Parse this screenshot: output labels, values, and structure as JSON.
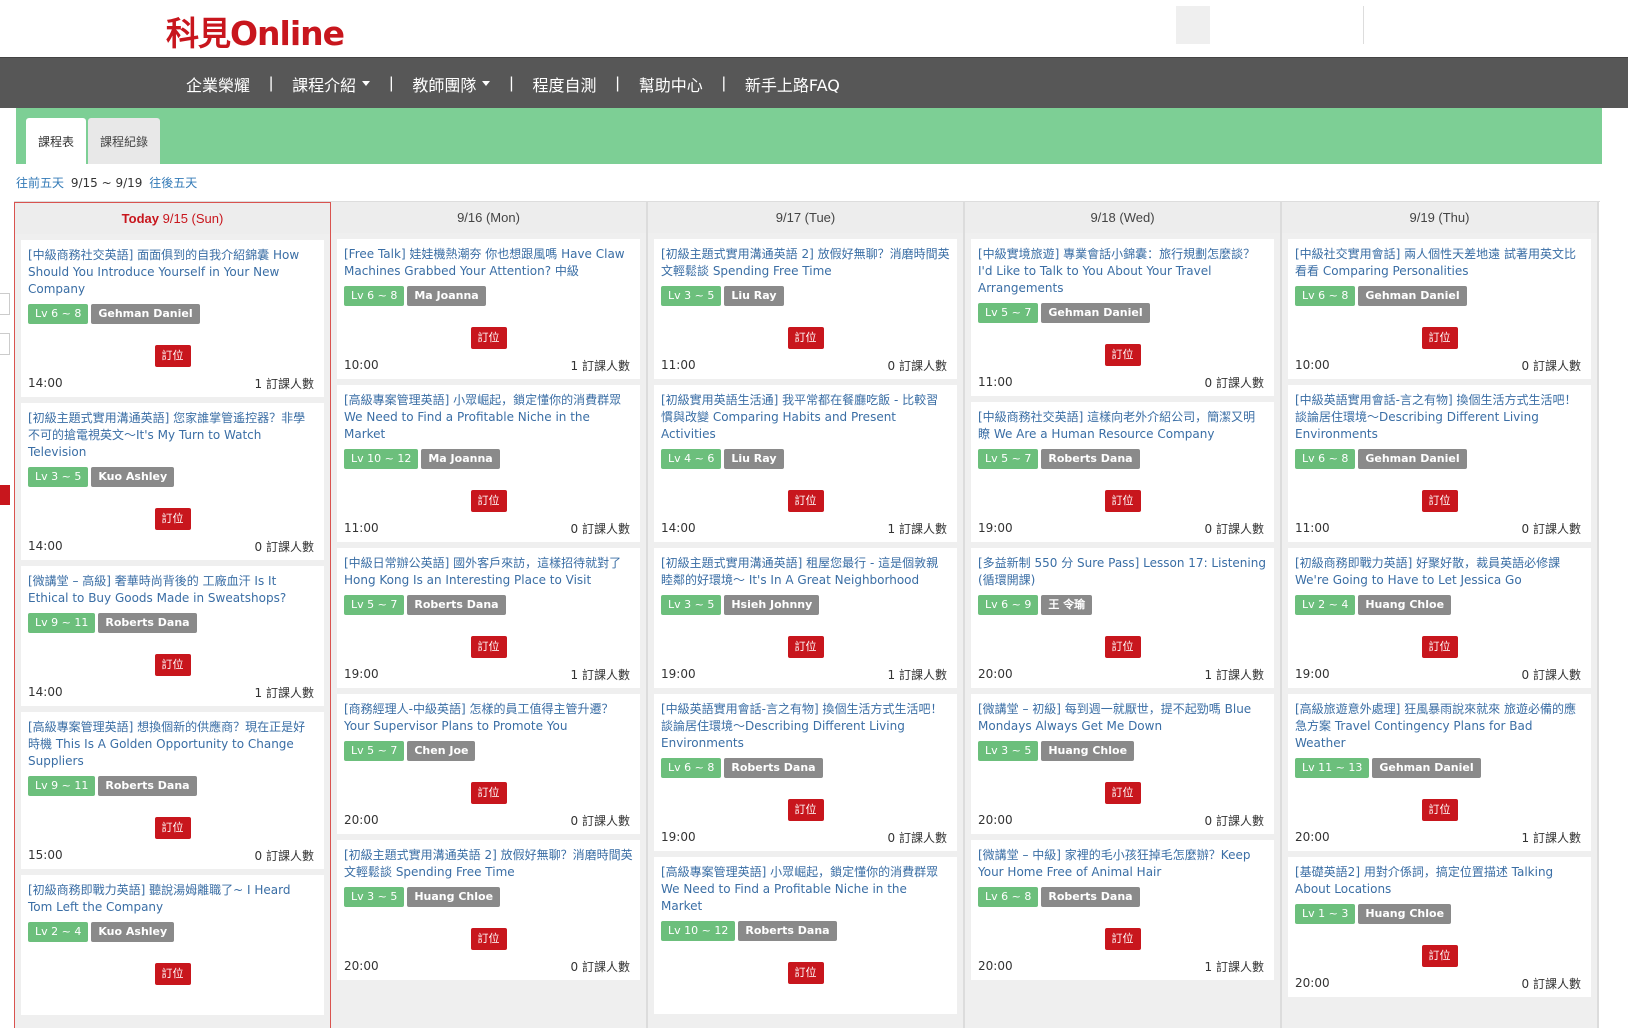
{
  "brand": {
    "logo": "科見Online"
  },
  "nav": {
    "items": [
      {
        "label": "企業榮耀",
        "has_dropdown": false
      },
      {
        "label": "課程介紹",
        "has_dropdown": true
      },
      {
        "label": "教師團隊",
        "has_dropdown": true
      },
      {
        "label": "程度自測",
        "has_dropdown": false
      },
      {
        "label": "幫助中心",
        "has_dropdown": false
      },
      {
        "label": "新手上路FAQ",
        "has_dropdown": false
      }
    ],
    "separator": "|"
  },
  "tabs": [
    {
      "label": "課程表"
    },
    {
      "label": "課程紀錄"
    }
  ],
  "range": {
    "prev": "往前五天",
    "current": "9/15 ~ 9/19",
    "next": "往後五天"
  },
  "book_label": "訂位",
  "count_suffix": "訂課人數",
  "colors": {
    "brand_red": "#c8161d",
    "level_green": "#6cbf7c",
    "teacher_gray": "#8a8a8a",
    "tab_bar_green": "#7dcf95",
    "link_blue": "#3a6ea5"
  },
  "days": [
    {
      "today_label": "Today",
      "date": "9/15 (Sun)",
      "courses": [
        {
          "title": "[中級商務社交英語] 面面俱到的自我介紹錦囊 How Should You Introduce Yourself in Your New Company",
          "level": "Lv 6 ~ 8",
          "teacher": "Gehman Daniel",
          "time": "14:00",
          "count": "1"
        },
        {
          "title": "[初級主題式實用溝通英語] 您家誰掌管遙控器？非學不可的搶電視英文～It's My Turn to Watch Television",
          "level": "Lv 3 ~ 5",
          "teacher": "Kuo Ashley",
          "time": "14:00",
          "count": "0"
        },
        {
          "title": "[微講堂 – 高級] 奢華時尚背後的 工廠血汗 Is It Ethical to Buy Goods Made in Sweatshops?",
          "level": "Lv 9 ~ 11",
          "teacher": "Roberts Dana",
          "time": "14:00",
          "count": "1"
        },
        {
          "title": "[高級專案管理英語] 想換個新的供應商？現在正是好時機 This Is A Golden Opportunity to Change Suppliers",
          "level": "Lv 9 ~ 11",
          "teacher": "Roberts Dana",
          "time": "15:00",
          "count": "0"
        },
        {
          "title": "[初級商務即戰力英語] 聽說湯姆離職了~ I Heard Tom Left the Company",
          "level": "Lv 2 ~ 4",
          "teacher": "Kuo Ashley",
          "time": "",
          "count": ""
        }
      ]
    },
    {
      "today_label": "",
      "date": "9/16 (Mon)",
      "courses": [
        {
          "title": "[Free Talk] 娃娃機熱潮夯 你也想跟風嗎 Have Claw Machines Grabbed Your Attention? 中級",
          "level": "Lv 6 ~ 8",
          "teacher": "Ma Joanna",
          "time": "10:00",
          "count": "1"
        },
        {
          "title": "[高級專案管理英語] 小眾崛起，鎖定懂你的消費群眾 We Need to Find a Profitable Niche in the Market",
          "level": "Lv 10 ~ 12",
          "teacher": "Ma Joanna",
          "time": "11:00",
          "count": "0"
        },
        {
          "title": "[中級日常辦公英語] 國外客戶來訪，這樣招待就對了 Hong Kong Is an Interesting Place to Visit",
          "level": "Lv 5 ~ 7",
          "teacher": "Roberts Dana",
          "time": "19:00",
          "count": "1"
        },
        {
          "title": "[商務經理人-中級英語] 怎樣的員工值得主管升遷？Your Supervisor Plans to Promote You",
          "level": "Lv 5 ~ 7",
          "teacher": "Chen Joe",
          "time": "20:00",
          "count": "0"
        },
        {
          "title": "[初級主題式實用溝通英語 2] 放假好無聊？消磨時間英文輕鬆談 Spending Free Time",
          "level": "Lv 3 ~ 5",
          "teacher": "Huang Chloe",
          "time": "20:00",
          "count": "0"
        }
      ]
    },
    {
      "today_label": "",
      "date": "9/17 (Tue)",
      "courses": [
        {
          "title": "[初級主題式實用溝通英語 2] 放假好無聊？消磨時間英文輕鬆談 Spending Free Time",
          "level": "Lv 3 ~ 5",
          "teacher": "Liu Ray",
          "time": "11:00",
          "count": "0"
        },
        {
          "title": "[初級實用英語生活通] 我平常都在餐廳吃飯 - 比較習慣與改變 Comparing Habits and Present Activities",
          "level": "Lv 4 ~ 6",
          "teacher": "Liu Ray",
          "time": "14:00",
          "count": "1"
        },
        {
          "title": "[初級主題式實用溝通英語] 租屋您最行 - 這是個敦親睦鄰的好環境～ It's In A Great Neighborhood",
          "level": "Lv 3 ~ 5",
          "teacher": "Hsieh Johnny",
          "time": "19:00",
          "count": "1"
        },
        {
          "title": "[中級英語實用會話-言之有物] 換個生活方式生活吧！談論居住環境～Describing Different Living Environments",
          "level": "Lv 6 ~ 8",
          "teacher": "Roberts Dana",
          "time": "19:00",
          "count": "0"
        },
        {
          "title": "[高級專案管理英語] 小眾崛起，鎖定懂你的消費群眾 We Need to Find a Profitable Niche in the Market",
          "level": "Lv 10 ~ 12",
          "teacher": "Roberts Dana",
          "time": "",
          "count": ""
        }
      ]
    },
    {
      "today_label": "",
      "date": "9/18 (Wed)",
      "courses": [
        {
          "title": "[中級實境旅遊] 專業會話小錦囊：旅行規劃怎麼談？I'd Like to Talk to You About Your Travel Arrangements",
          "level": "Lv 5 ~ 7",
          "teacher": "Gehman Daniel",
          "time": "11:00",
          "count": "0"
        },
        {
          "title": "[中級商務社交英語] 這樣向老外介紹公司，簡潔又明瞭 We Are a Human Resource Company",
          "level": "Lv 5 ~ 7",
          "teacher": "Roberts Dana",
          "time": "19:00",
          "count": "0"
        },
        {
          "title": "[多益新制 550 分 Sure Pass] Lesson 17: Listening (循環開課)",
          "level": "Lv 6 ~ 9",
          "teacher": "王 令瑜",
          "time": "20:00",
          "count": "1"
        },
        {
          "title": "[微講堂 – 初級] 每到週一就厭世，提不起勁嗎 Blue Mondays Always Get Me Down",
          "level": "Lv 3 ~ 5",
          "teacher": "Huang Chloe",
          "time": "20:00",
          "count": "0"
        },
        {
          "title": "[微講堂 – 中級] 家裡的毛小孩狂掉毛怎麼辦？Keep Your Home Free of Animal Hair",
          "level": "Lv 6 ~ 8",
          "teacher": "Roberts Dana",
          "time": "20:00",
          "count": "1"
        }
      ]
    },
    {
      "today_label": "",
      "date": "9/19 (Thu)",
      "courses": [
        {
          "title": "[中級社交實用會話] 兩人個性天差地遠 試著用英文比看看 Comparing Personalities",
          "level": "Lv 6 ~ 8",
          "teacher": "Gehman Daniel",
          "time": "10:00",
          "count": "0"
        },
        {
          "title": "[中級英語實用會話-言之有物] 換個生活方式生活吧！談論居住環境～Describing Different Living Environments",
          "level": "Lv 6 ~ 8",
          "teacher": "Gehman Daniel",
          "time": "11:00",
          "count": "0"
        },
        {
          "title": "[初級商務即戰力英語] 好聚好散，裁員英語必修課 We're Going to Have to Let Jessica Go",
          "level": "Lv 2 ~ 4",
          "teacher": "Huang Chloe",
          "time": "19:00",
          "count": "0"
        },
        {
          "title": "[高級旅遊意外處理] 狂風暴雨說來就來 旅遊必備的應急方案 Travel Contingency Plans for Bad Weather",
          "level": "Lv 11 ~ 13",
          "teacher": "Gehman Daniel",
          "time": "20:00",
          "count": "1"
        },
        {
          "title": "[基礎英語2] 用對介係詞，搞定位置描述 Talking About Locations",
          "level": "Lv 1 ~ 3",
          "teacher": "Huang Chloe",
          "time": "20:00",
          "count": "0"
        }
      ]
    }
  ]
}
